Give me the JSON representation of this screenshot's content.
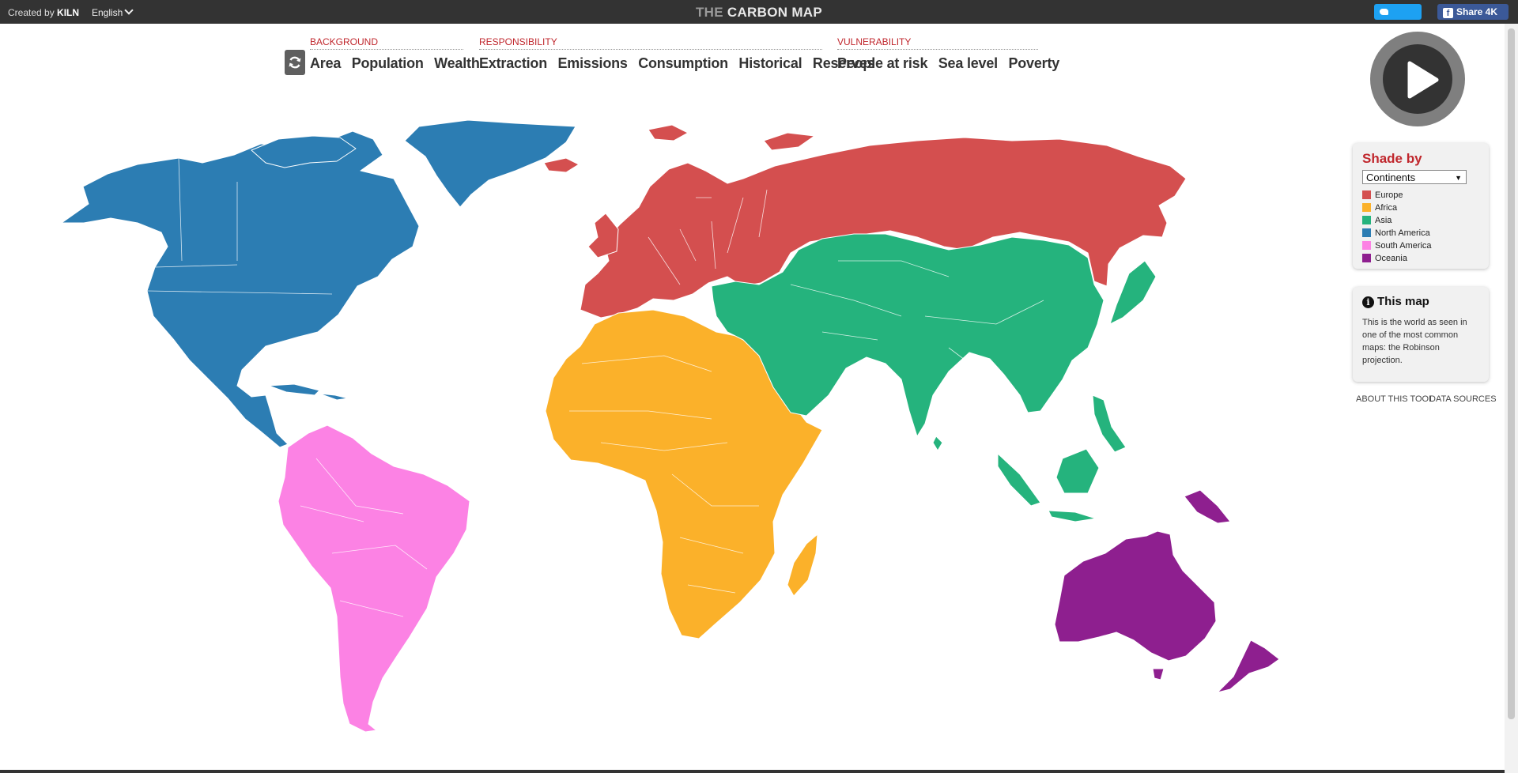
{
  "header": {
    "created_prefix": "Created by",
    "created_brand": "KILN",
    "language": "English",
    "title_prefix": "THE",
    "title_main": "CARBON MAP",
    "tweet_label": "Tweet",
    "share_label": "Share 4K"
  },
  "nav": {
    "groups": [
      {
        "category": "BACKGROUND",
        "items": [
          "Area",
          "Population",
          "Wealth"
        ]
      },
      {
        "category": "RESPONSIBILITY",
        "items": [
          "Extraction",
          "Emissions",
          "Consumption",
          "Historical",
          "Reserves"
        ]
      },
      {
        "category": "VULNERABILITY",
        "items": [
          "People at risk",
          "Sea level",
          "Poverty"
        ]
      }
    ]
  },
  "shade_by": {
    "title": "Shade by",
    "selected": "Continents",
    "legend": [
      {
        "label": "Europe",
        "color": "#d44f4f"
      },
      {
        "label": "Africa",
        "color": "#fbb12a"
      },
      {
        "label": "Asia",
        "color": "#25b37d"
      },
      {
        "label": "North America",
        "color": "#2c7db3"
      },
      {
        "label": "South America",
        "color": "#fc82e4"
      },
      {
        "label": "Oceania",
        "color": "#8e1f8f"
      }
    ]
  },
  "info": {
    "title": "This map",
    "text": "This is the world as seen in one of the most common maps: the Robinson projection."
  },
  "links": {
    "about": "ABOUT THIS TOOL",
    "sources": "DATA SOURCES"
  },
  "map": {
    "projection": "Robinson",
    "regions": [
      {
        "name": "north-america",
        "color": "#2c7db3"
      },
      {
        "name": "south-america",
        "color": "#fc82e4"
      },
      {
        "name": "europe",
        "color": "#d44f4f"
      },
      {
        "name": "africa",
        "color": "#fbb12a"
      },
      {
        "name": "asia",
        "color": "#25b37d"
      },
      {
        "name": "oceania",
        "color": "#8e1f8f"
      }
    ]
  }
}
